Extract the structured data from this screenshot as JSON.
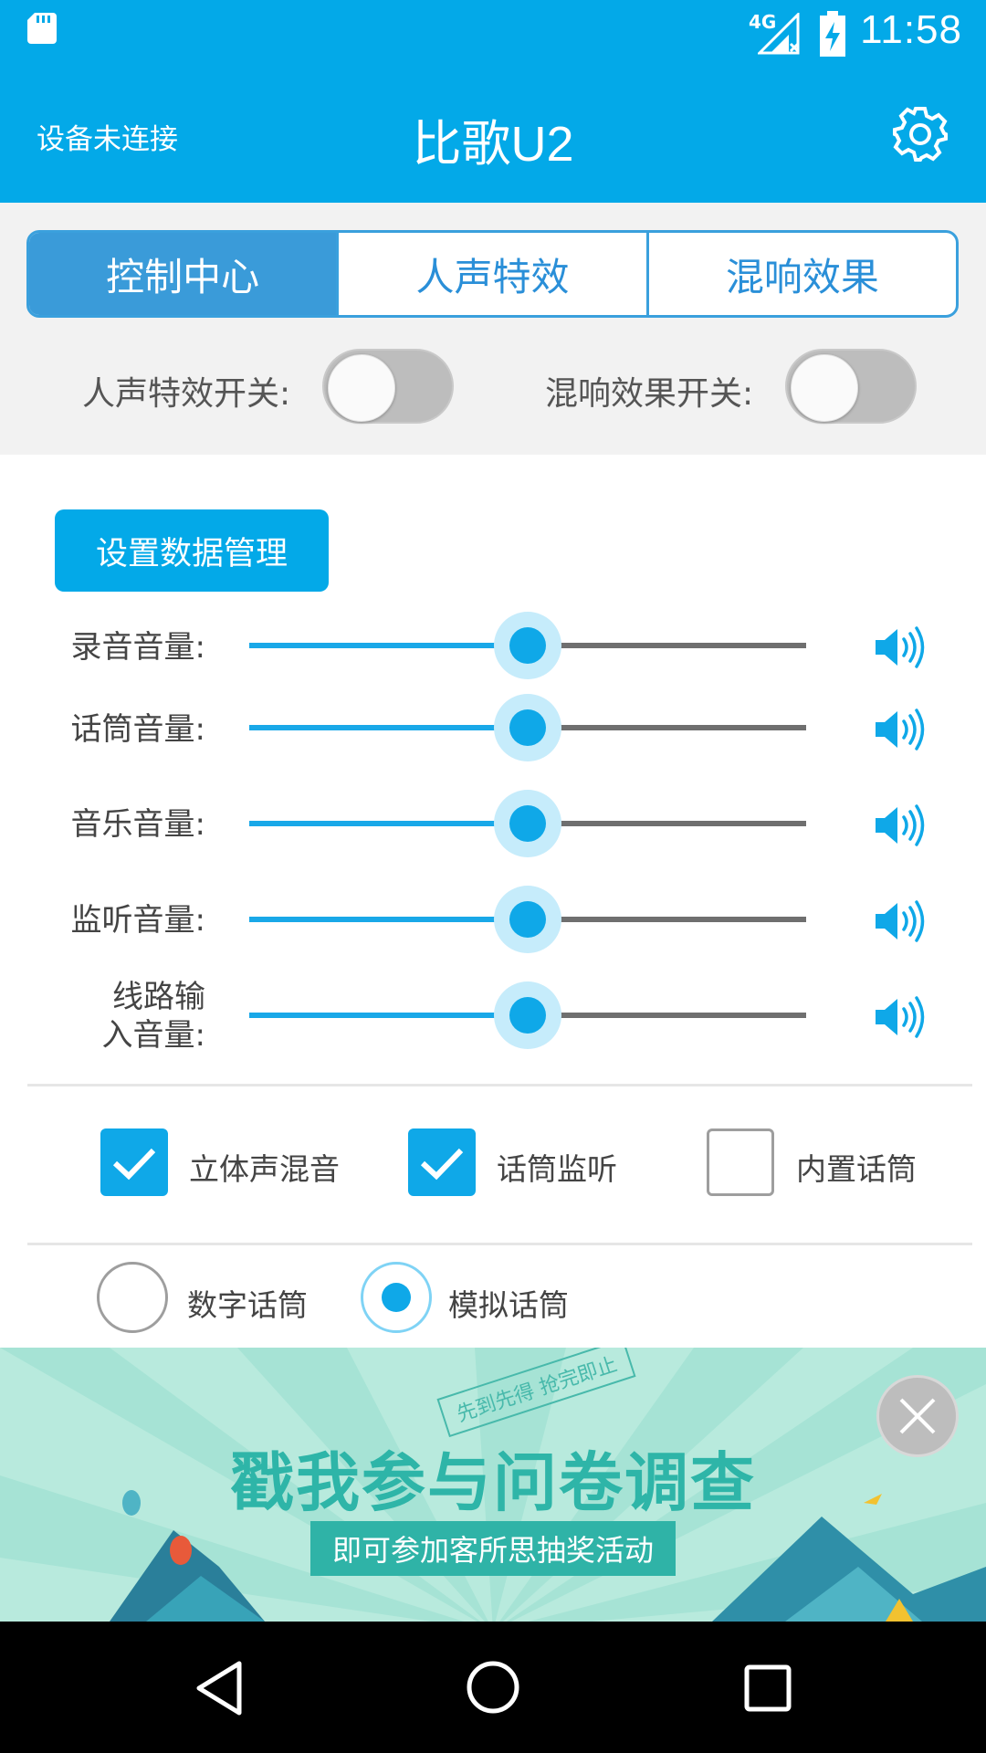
{
  "status_bar": {
    "time": "11:58",
    "network": "4G",
    "icons": [
      "sd-card-icon",
      "signal-icon",
      "battery-charging-icon"
    ]
  },
  "app_bar": {
    "connection_status": "设备未连接",
    "title": "比歌U2",
    "settings_icon": "gear-icon"
  },
  "tabs": [
    {
      "label": "控制中心",
      "active": true
    },
    {
      "label": "人声特效",
      "active": false
    },
    {
      "label": "混响效果",
      "active": false
    }
  ],
  "switches": [
    {
      "label": "人声特效开关:",
      "on": false
    },
    {
      "label": "混响效果开关:",
      "on": false
    }
  ],
  "manage_button": "设置数据管理",
  "sliders": [
    {
      "label": "录音音量:",
      "value": 0.5
    },
    {
      "label": "话筒音量:",
      "value": 0.5
    },
    {
      "label": "音乐音量:",
      "value": 0.5
    },
    {
      "label": "监听音量:",
      "value": 0.5
    },
    {
      "label_line1": "线路输",
      "label_line2": "入音量:",
      "value": 0.5
    }
  ],
  "checkboxes": [
    {
      "label": "立体声混音",
      "checked": true
    },
    {
      "label": "话筒监听",
      "checked": true
    },
    {
      "label": "内置话筒",
      "checked": false
    }
  ],
  "radios": [
    {
      "label": "数字话筒",
      "selected": false
    },
    {
      "label": "模拟话筒",
      "selected": true
    }
  ],
  "banner": {
    "stamp": "先到先得 抢完即止",
    "headline": "戳我参与问卷调查",
    "subline": "即可参加客所思抽奖活动"
  },
  "colors": {
    "primary": "#03a9e8",
    "tab_active": "#3a9bd9",
    "banner_bg": "#b8eadd"
  }
}
